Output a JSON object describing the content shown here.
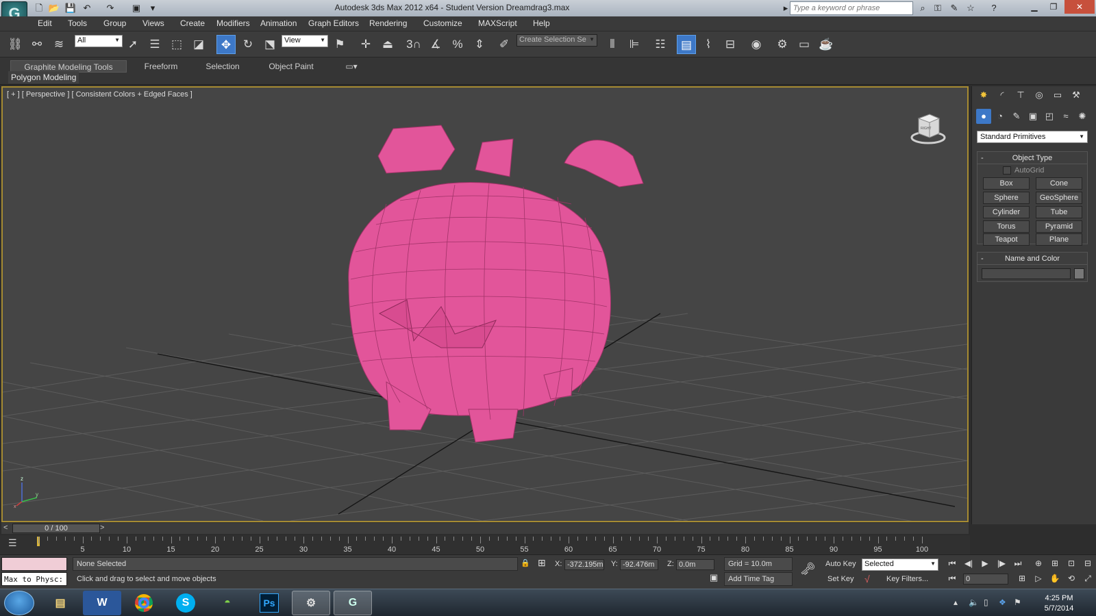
{
  "app": {
    "window_title": "Autodesk 3ds Max  2012 x64   - Student Version    Dreamdrag3.max",
    "search_placeholder": "Type a keyword or phrase"
  },
  "menu": [
    "Edit",
    "Tools",
    "Group",
    "Views",
    "Create",
    "Modifiers",
    "Animation",
    "Graph Editors",
    "Rendering",
    "Customize",
    "MAXScript",
    "Help"
  ],
  "toolbar": {
    "filter_value": "All",
    "refcoord_value": "View",
    "selection_set_placeholder": "Create Selection Se",
    "snap_label": "3"
  },
  "ribbon": {
    "tabs": [
      "Graphite Modeling Tools",
      "Freeform",
      "Selection",
      "Object Paint"
    ],
    "subtab": "Polygon Modeling"
  },
  "viewport": {
    "label": "[ + ] [ Perspective ] [ Consistent Colors + Edged Faces ]",
    "viewcube_face": "RIGHT",
    "axis_z": "z",
    "axis_x": "x",
    "axis_y": "y",
    "model_color": "#e2559a"
  },
  "command_panel": {
    "dropdown_value": "Standard Primitives",
    "object_type_title": "Object Type",
    "autogrid_label": "AutoGrid",
    "primitives": [
      "Box",
      "Cone",
      "Sphere",
      "GeoSphere",
      "Cylinder",
      "Tube",
      "Torus",
      "Pyramid",
      "Teapot",
      "Plane"
    ],
    "name_color_title": "Name and Color"
  },
  "timeline": {
    "slider_text": "0 / 100",
    "ticks": [
      "5",
      "10",
      "15",
      "20",
      "25",
      "30",
      "35",
      "40",
      "45",
      "50",
      "55",
      "60",
      "65",
      "70",
      "75",
      "80",
      "85",
      "90",
      "95",
      "100"
    ]
  },
  "status": {
    "script_listener": "Max to Physc:",
    "selection_text": "None Selected",
    "prompt_text": "Click and drag to select and move objects",
    "x_label": "X:",
    "x_value": "-372.195m",
    "y_label": "Y:",
    "y_value": "-92.476m",
    "z_label": "Z:",
    "z_value": "0.0m",
    "grid": "Grid = 10.0m",
    "add_time_tag": "Add Time Tag",
    "auto_key": "Auto Key",
    "set_key": "Set Key",
    "key_mode_value": "Selected",
    "key_filters": "Key Filters...",
    "frame_value": "0"
  },
  "taskbar": {
    "time": "4:25 PM",
    "date": "5/7/2014"
  }
}
